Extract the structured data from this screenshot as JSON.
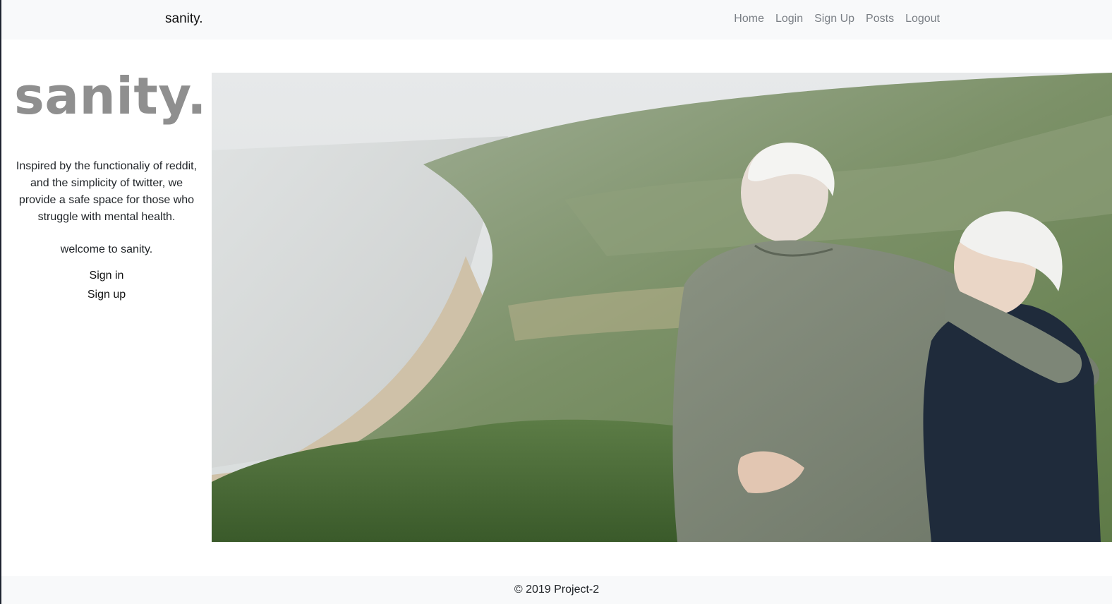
{
  "navbar": {
    "brand": "sanity.",
    "links": [
      "Home",
      "Login",
      "Sign Up",
      "Posts",
      "Logout"
    ]
  },
  "sidebar": {
    "title": "sanity.",
    "description": "Inspired by the functionaliy of reddit, and the simplicity of twitter, we provide a safe space for those who struggle with mental health.",
    "welcome": "welcome to sanity.",
    "signin_label": "Sign in",
    "signup_label": "Sign up"
  },
  "hero": {
    "image_alt": "Elderly couple embracing on a hillside overlooking a misty coastline"
  },
  "footer": {
    "text": "© 2019 Project-2"
  },
  "colors": {
    "navbar_bg": "#f8f9fa",
    "title_gray": "#8f8f8f",
    "link_gray": "#7a7f85"
  }
}
